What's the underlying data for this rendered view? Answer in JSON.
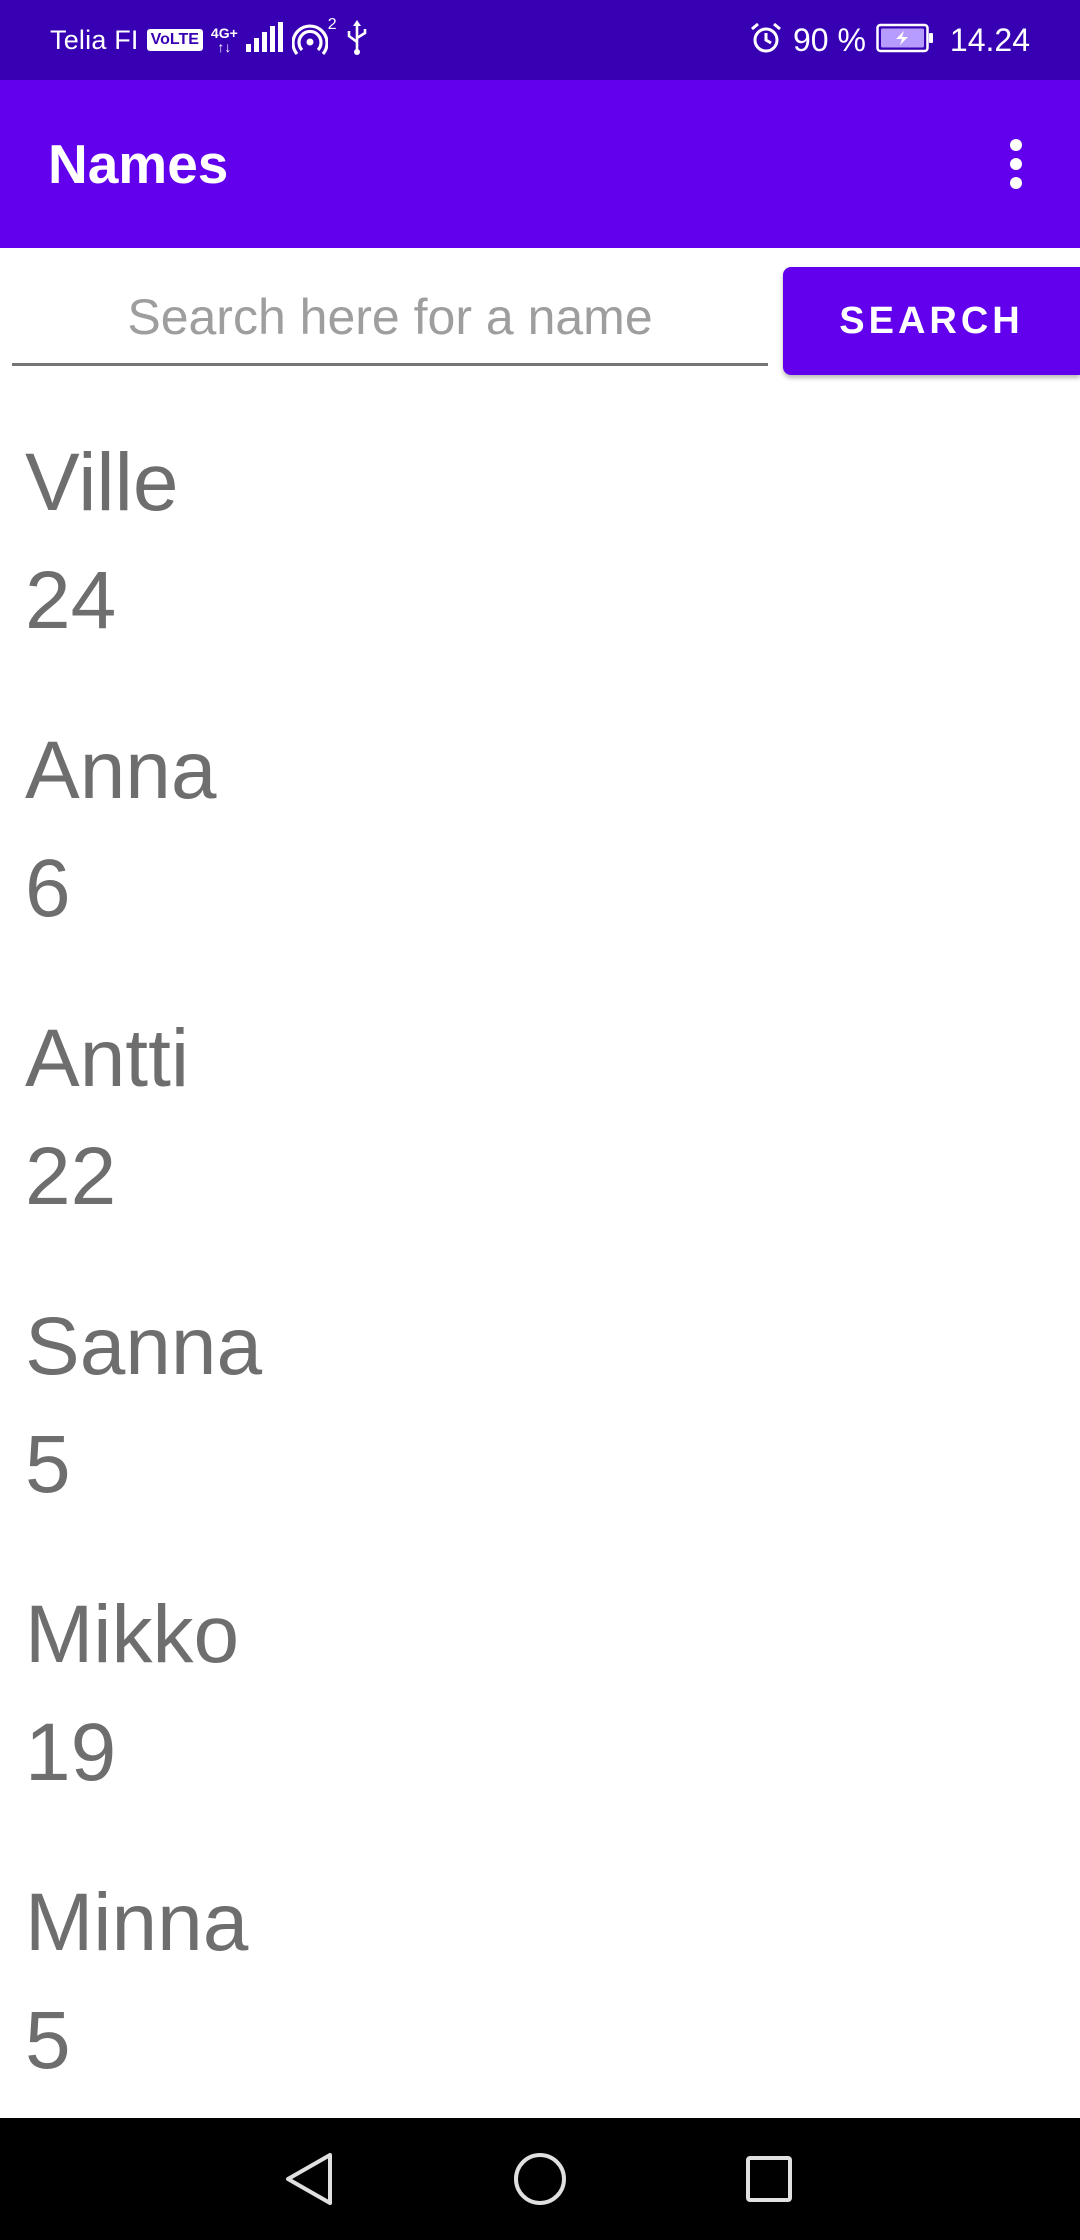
{
  "status_bar": {
    "carrier": "Telia FI",
    "volte_badge": "VoLTE",
    "network_type_top": "4G+",
    "network_type_bottom": "↑↓",
    "hotspot_count": "2",
    "battery_percent": "90 %",
    "time": "14.24",
    "icons": [
      "signal-icon",
      "hotspot-icon",
      "usb-icon",
      "alarm-icon",
      "battery-charging-icon"
    ]
  },
  "app_bar": {
    "title": "Names",
    "overflow_icon": "more-vert-icon"
  },
  "search": {
    "placeholder": "Search here for a name",
    "value": "",
    "button_label": "SEARCH"
  },
  "names": [
    {
      "name": "Ville",
      "count": "24"
    },
    {
      "name": "Anna",
      "count": "6"
    },
    {
      "name": "Antti",
      "count": "22"
    },
    {
      "name": "Sanna",
      "count": "5"
    },
    {
      "name": "Mikko",
      "count": "19"
    },
    {
      "name": "Minna",
      "count": "5"
    }
  ],
  "nav_bar": {
    "icons": [
      "back-icon",
      "home-icon",
      "recents-icon"
    ]
  },
  "colors": {
    "status_bar": "#3700b3",
    "primary": "#6200ee",
    "list_text": "#6e6e6e",
    "nav_bar": "#000000"
  }
}
